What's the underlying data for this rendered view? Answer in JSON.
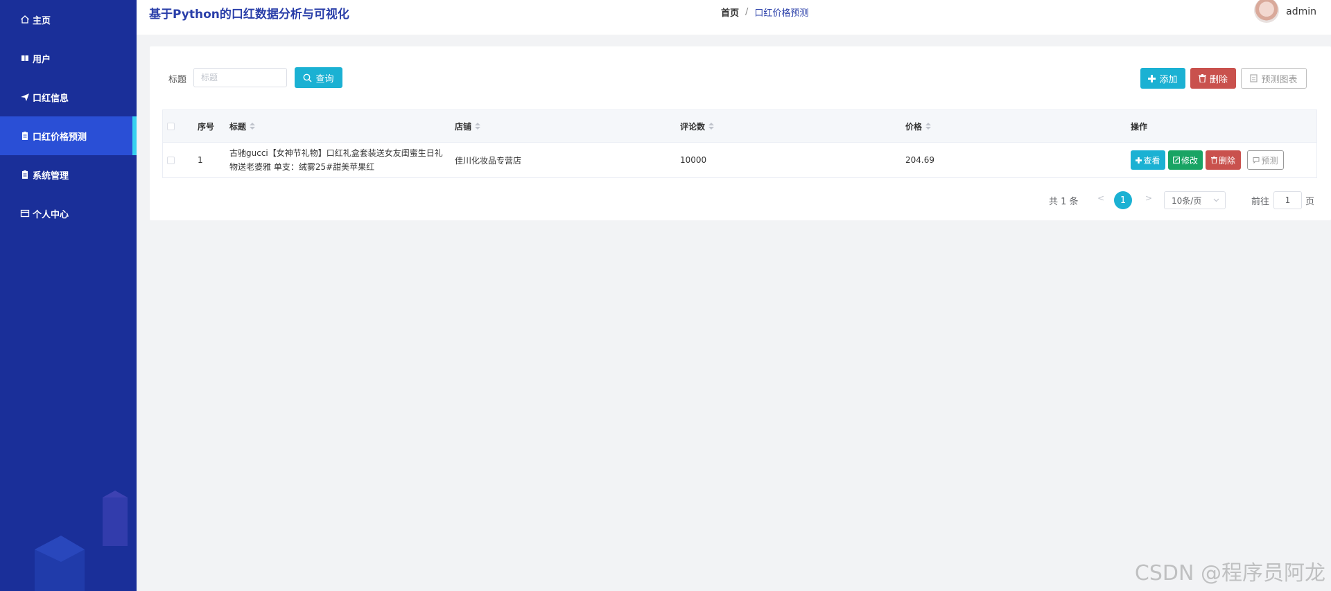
{
  "app": {
    "title": "基于Python的口红数据分析与可视化"
  },
  "sidebar": {
    "items": [
      {
        "label": "主页",
        "icon": "home-icon"
      },
      {
        "label": "用户",
        "icon": "book-icon"
      },
      {
        "label": "口红信息",
        "icon": "send-icon"
      },
      {
        "label": "口红价格预测",
        "icon": "clipboard-icon",
        "active": true
      },
      {
        "label": "系统管理",
        "icon": "clipboard-icon"
      },
      {
        "label": "个人中心",
        "icon": "wallet-icon"
      }
    ]
  },
  "breadcrumb": {
    "home": "首页",
    "separator": "/",
    "current": "口红价格预测"
  },
  "user": {
    "name": "admin"
  },
  "search": {
    "label": "标题",
    "placeholder": "标题",
    "value": "",
    "button": "查询"
  },
  "toolbar": {
    "add": "添加",
    "delete": "删除",
    "chart": "预测图表"
  },
  "table": {
    "headers": {
      "index": "序号",
      "title": "标题",
      "shop": "店铺",
      "comments": "评论数",
      "price": "价格",
      "actions": "操作"
    },
    "rows": [
      {
        "index": "1",
        "title": "古驰gucci【女神节礼物】口红礼盒套装送女友闺蜜生日礼物送老婆雅 单支：绒雾25#甜美苹果红",
        "shop": "佳川化妆品专营店",
        "comments": "10000",
        "price": "204.69"
      }
    ],
    "row_actions": {
      "view": "查看",
      "edit": "修改",
      "delete": "删除",
      "predict": "预测"
    }
  },
  "pagination": {
    "total": "共 1 条",
    "prev": "<",
    "next": ">",
    "current": "1",
    "page_size": "10条/页",
    "goto_label": "前往",
    "goto_value": "1",
    "page_label": "页"
  },
  "watermark": "CSDN @程序员阿龙",
  "colors": {
    "sidebar_bg": "#1a2f99",
    "sidebar_active": "#2a4fd6",
    "accent": "#1bb1d3",
    "danger": "#c9514d",
    "success": "#19a464",
    "title": "#2a3fa9"
  }
}
